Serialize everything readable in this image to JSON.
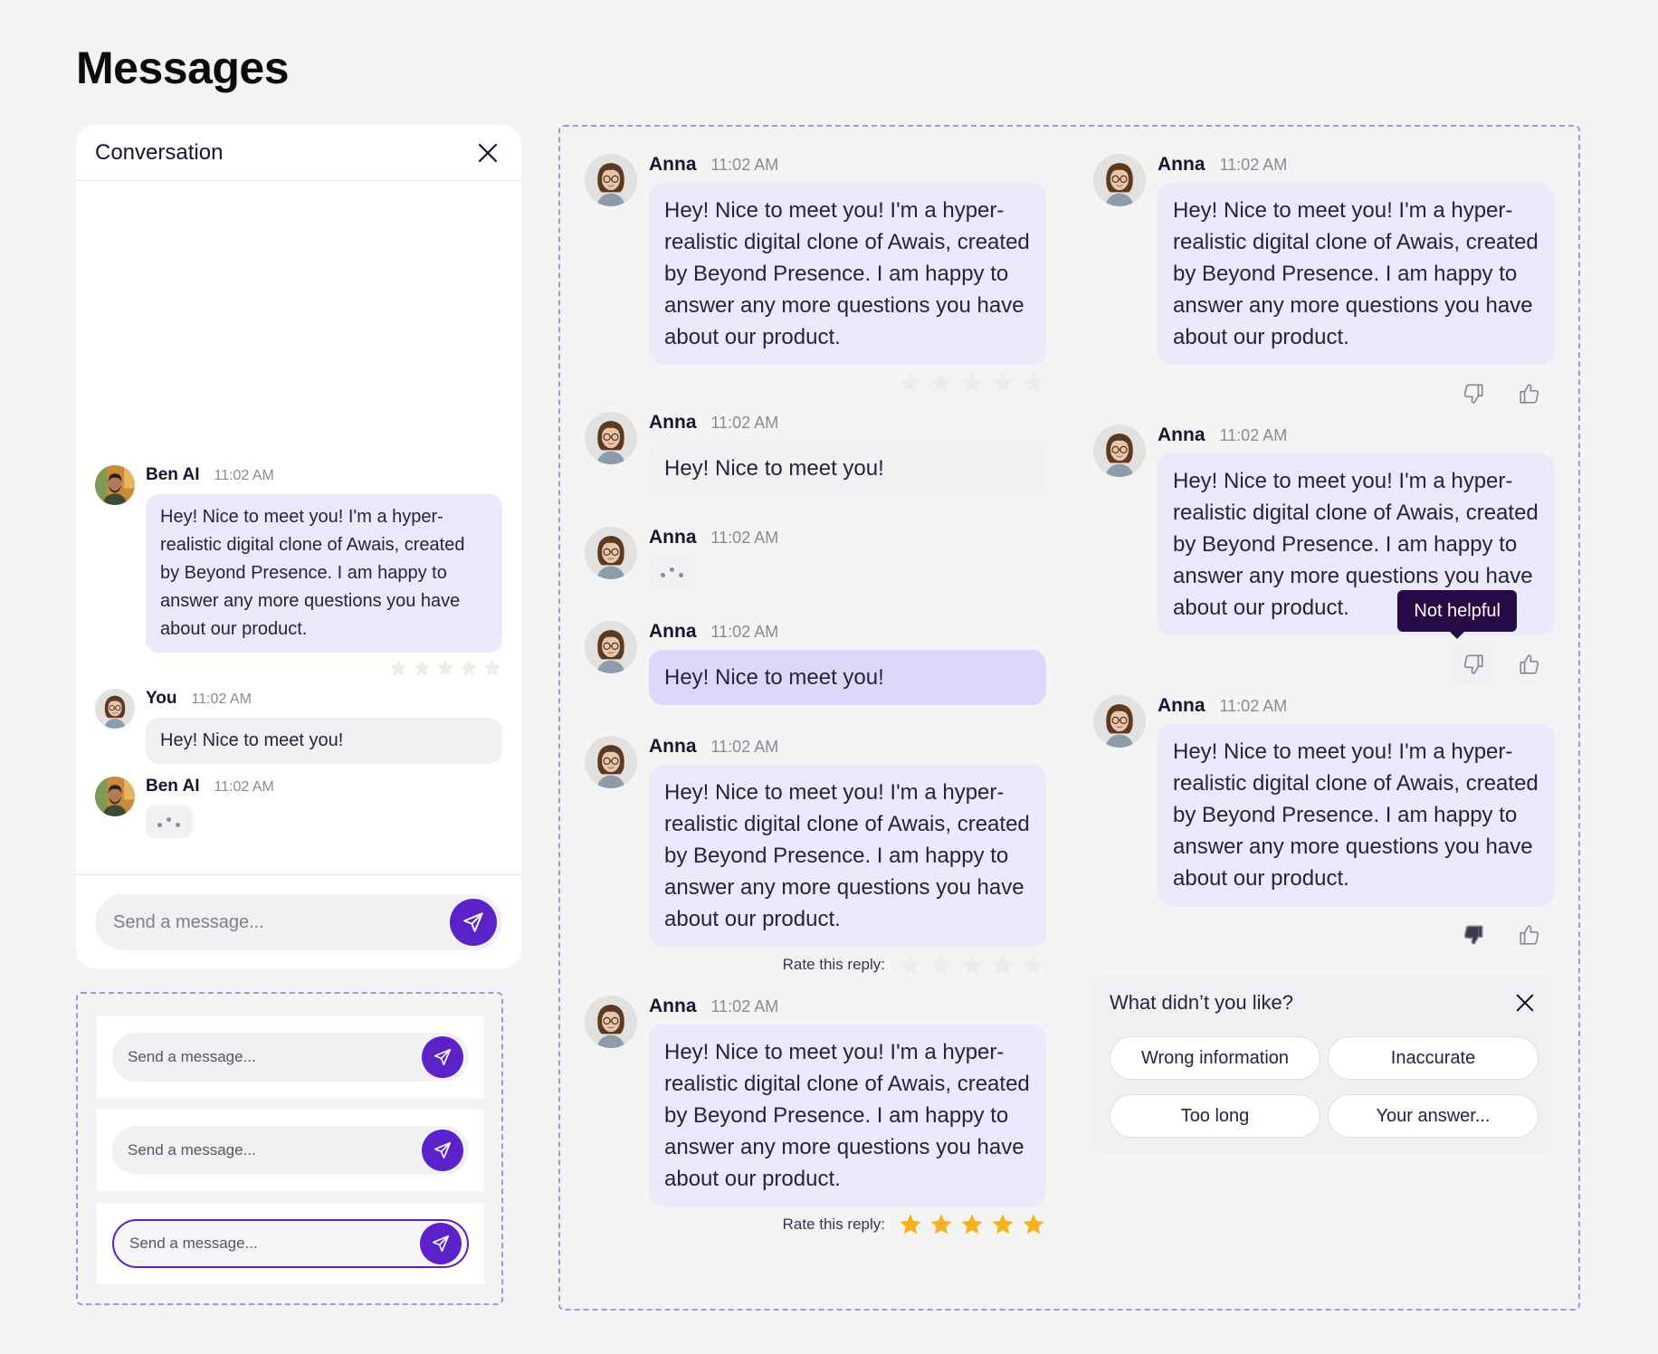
{
  "page": {
    "title": "Messages"
  },
  "conversation": {
    "title": "Conversation",
    "messages": [
      {
        "sender": "Ben AI",
        "time": "11:02 AM",
        "text": "Hey! Nice to meet you! I'm a hyper-realistic digital clone of Awais, created by Beyond Presence. I am happy to answer any more questions you have about our product.",
        "rating": 0
      },
      {
        "sender": "You",
        "time": "11:02 AM",
        "text": "Hey! Nice to meet you!"
      },
      {
        "sender": "Ben AI",
        "time": "11:02 AM",
        "typing": true
      }
    ],
    "input": {
      "placeholder": "Send a message..."
    }
  },
  "input_variants": [
    {
      "placeholder": "Send a message...",
      "state": "default"
    },
    {
      "placeholder": "Send a message...",
      "state": "hover"
    },
    {
      "placeholder": "Send a message...",
      "state": "focused"
    }
  ],
  "left_column": [
    {
      "sender": "Anna",
      "time": "11:02 AM",
      "text": "Hey! Nice to meet you! I'm a hyper-realistic digital clone of Awais, created by Beyond Presence. I am happy to answer any more questions you have about our product.",
      "rating": 0
    },
    {
      "sender": "Anna",
      "time": "11:02 AM",
      "text": "Hey! Nice to meet you!"
    },
    {
      "sender": "Anna",
      "time": "11:02 AM",
      "typing": true
    },
    {
      "sender": "Anna",
      "time": "11:02 AM",
      "text": "Hey! Nice to meet you!"
    },
    {
      "sender": "Anna",
      "time": "11:02 AM",
      "text": "Hey! Nice to meet you! I'm a hyper-realistic digital clone of Awais, created by Beyond Presence. I am happy to answer any more questions you have about our product.",
      "rate_label": "Rate this reply:",
      "rating": 0
    },
    {
      "sender": "Anna",
      "time": "11:02 AM",
      "text": "Hey! Nice to meet you! I'm a hyper-realistic digital clone of Awais, created by Beyond Presence. I am happy to answer any more questions you have about our product.",
      "rate_label": "Rate this reply:",
      "rating": 5
    }
  ],
  "right_column": [
    {
      "sender": "Anna",
      "time": "11:02 AM",
      "text": "Hey! Nice to meet you! I'm a hyper-realistic digital clone of Awais, created by Beyond Presence. I am happy to answer any more questions you have about our product.",
      "feedback": "none"
    },
    {
      "sender": "Anna",
      "time": "11:02 AM",
      "text": "Hey! Nice to meet you! I'm a hyper-realistic digital clone of Awais, created by Beyond Presence. I am happy to answer any more questions you have about our product.",
      "feedback": "hover-down",
      "tooltip": "Not helpful"
    },
    {
      "sender": "Anna",
      "time": "11:02 AM",
      "text": "Hey! Nice to meet you! I'm a hyper-realistic digital clone of Awais, created by Beyond Presence. I am happy to answer any more questions you have about our product.",
      "feedback": "down"
    }
  ],
  "feedback_panel": {
    "title": "What didn’t you like?",
    "options": [
      "Wrong information",
      "Inaccurate",
      "Too long",
      "Your answer..."
    ]
  },
  "colors": {
    "accent": "#5a22c8",
    "bubble_lavender": "#ebe9fc",
    "bubble_gray": "#f1f1f4",
    "star_active": "#f5b21b",
    "star_inactive": "#ececef",
    "dashed_border": "#b58be8"
  }
}
